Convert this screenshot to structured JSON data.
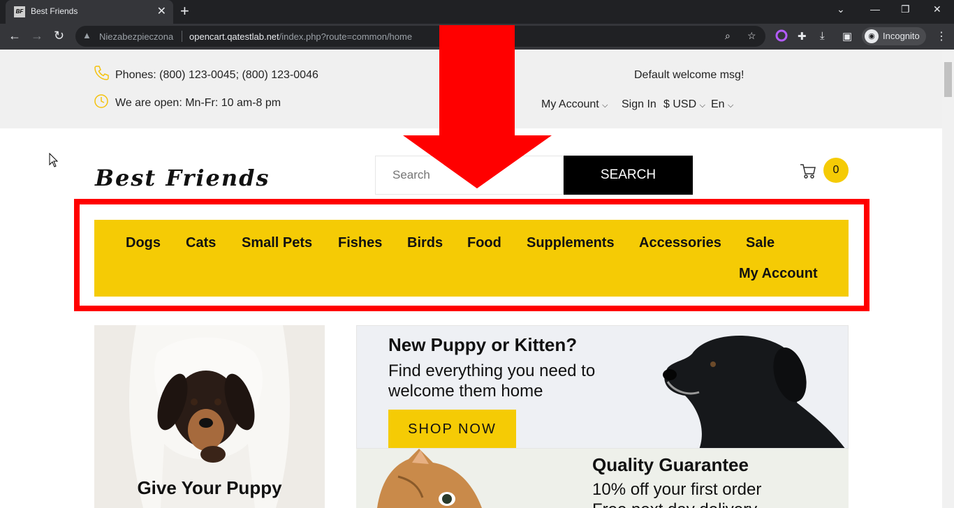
{
  "browser": {
    "tab_title": "Best Friends",
    "favicon_text": "BF",
    "insecure_label": "Niezabezpieczona",
    "url_host": "opencart.qatestlab.net",
    "url_path": "/index.php?route=common/home",
    "incognito_label": "Incognito"
  },
  "infobar": {
    "phones": "Phones: (800) 123-0045; (800) 123-0046",
    "hours": "We are open: Mn-Fr: 10 am-8 pm",
    "welcome": "Default welcome msg!",
    "my_account": "My Account",
    "sign_in": "Sign In",
    "currency": "$ USD",
    "language": "En"
  },
  "header": {
    "logo_text": "Best Friends",
    "search_placeholder": "Search",
    "search_button": "SEARCH",
    "cart_count": "0"
  },
  "nav": {
    "items": [
      "Dogs",
      "Cats",
      "Small Pets",
      "Fishes",
      "Birds",
      "Food",
      "Supplements",
      "Accessories",
      "Sale",
      "My Account"
    ]
  },
  "content": {
    "left_card_title": "Give Your Puppy",
    "banner1_title": "New Puppy or Kitten?",
    "banner1_sub": "Find everything you need to welcome them home",
    "banner1_button": "SHOP NOW",
    "banner2_title": "Quality Guarantee",
    "banner2_line1": "10% off your first order",
    "banner2_line2": "Free next day delivery"
  },
  "colors": {
    "brand_yellow": "#f5cb05",
    "annotation_red": "#ff0000",
    "chrome_dark": "#202124"
  }
}
